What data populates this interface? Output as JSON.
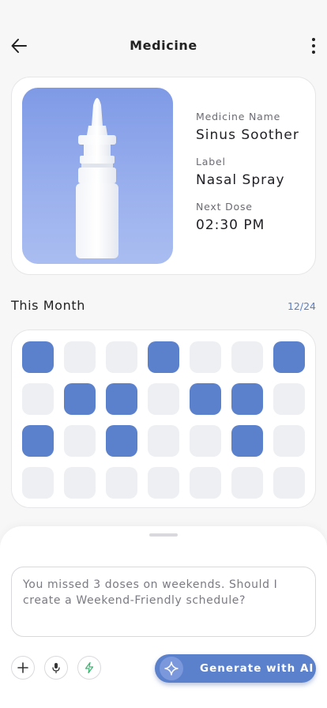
{
  "header": {
    "title": "Medicine",
    "back_icon": "arrow-left-icon",
    "menu_icon": "more-vertical-icon"
  },
  "medicine": {
    "name_label": "Medicine Name",
    "name": "Sinus Soother",
    "type_label": "Label",
    "type": "Nasal Spray",
    "next_label": "Next Dose",
    "next_dose": "02:30 PM",
    "image_icon": "nasal-spray-bottle-image"
  },
  "month": {
    "title": "This Month",
    "count": "12/24",
    "taken_color": "#5b80cc",
    "empty_color": "#edeff2",
    "days": [
      true,
      false,
      false,
      true,
      false,
      false,
      true,
      false,
      true,
      true,
      false,
      true,
      true,
      false,
      true,
      false,
      true,
      false,
      false,
      true,
      false,
      false,
      false,
      false,
      false,
      false,
      false,
      false
    ]
  },
  "assistant": {
    "prompt": "You missed 3 doses on weekends. Should I create a Weekend-Friendly schedule?",
    "add_icon": "plus-icon",
    "mic_icon": "microphone-icon",
    "bolt_icon": "lightning-icon",
    "generate_label": "Generate with AI",
    "generate_icon": "sparkle-icon",
    "accent": "#5b80cc"
  }
}
